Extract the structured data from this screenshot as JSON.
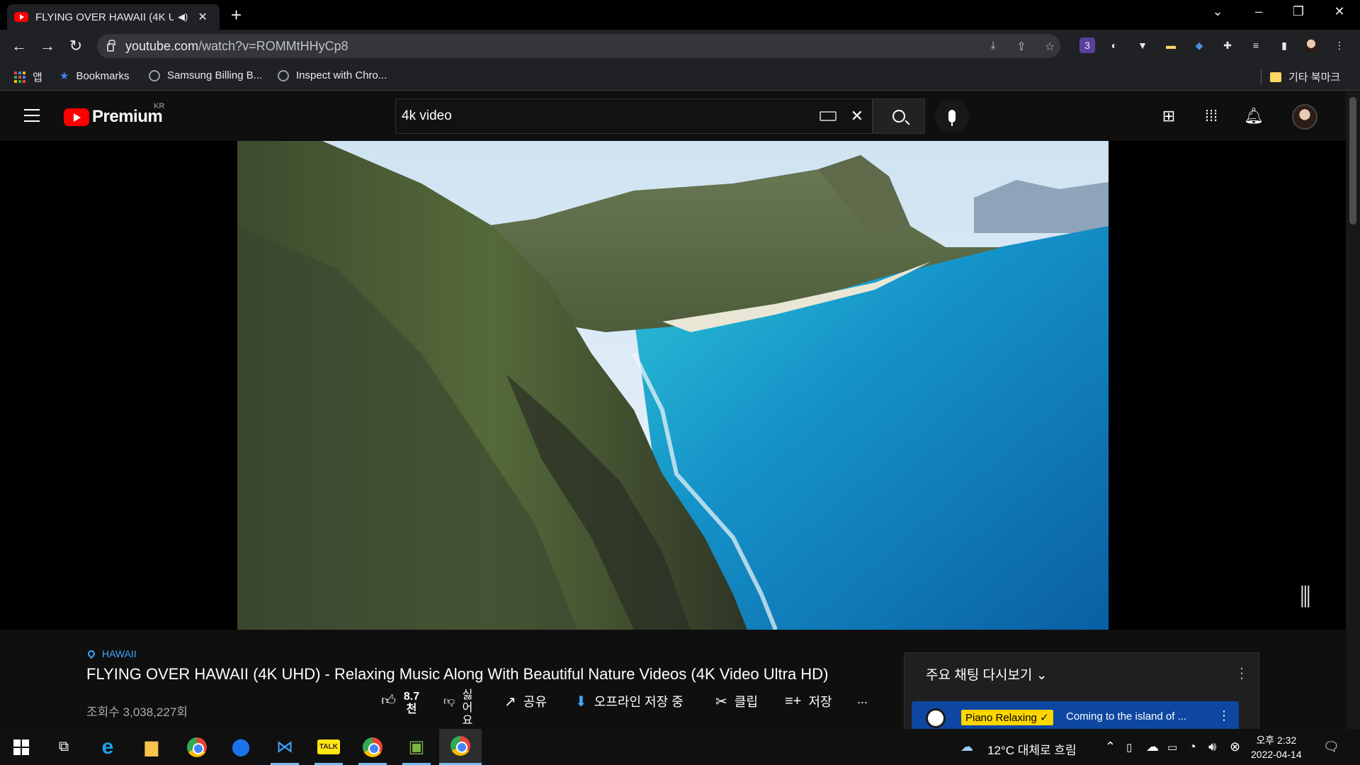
{
  "browser": {
    "tab_title": "FLYING OVER HAWAII (4K U",
    "tab_audio_icon": "speaker-icon",
    "url_host": "youtube.com",
    "url_path": "/watch?v=ROMMtHHyCp8",
    "bookmarks": [
      {
        "label": "앱",
        "icon": "apps-grid-icon"
      },
      {
        "label": "Bookmarks",
        "icon": "star-icon"
      },
      {
        "label": "Samsung Billing B...",
        "icon": "globe-icon"
      },
      {
        "label": "Inspect with Chro...",
        "icon": "globe-icon"
      }
    ],
    "other_bookmarks": "기타 북마크",
    "extension_badge": "3"
  },
  "youtube": {
    "logo_text": "Premium",
    "region": "KR",
    "search_query": "4k video"
  },
  "video": {
    "location": "HAWAII",
    "title": "FLYING OVER HAWAII (4K UHD) - Relaxing Music Along With Beautiful Nature Videos (4K Video Ultra HD)",
    "views": "조회수 3,038,227회",
    "likes_line1": "8.7",
    "likes_line2": "천",
    "dislike_label": "싫어요",
    "share": "공유",
    "download": "오프라인 저장 중",
    "clip": "클립",
    "save": "저장",
    "more": "..."
  },
  "chat": {
    "title": "주요 채팅 다시보기",
    "chevron": "chevron-down-icon",
    "badge": "Piano Relaxing ✓",
    "message": "Coming to the island of ..."
  },
  "taskbar": {
    "weather": "12°C  대체로 흐림",
    "time": "오후 2:32",
    "date": "2022-04-14"
  },
  "colors": {
    "yt_red": "#ff0000",
    "link_blue": "#3ea6ff",
    "chat_highlight": "#0d47a1",
    "badge_yellow": "#ffd600"
  }
}
